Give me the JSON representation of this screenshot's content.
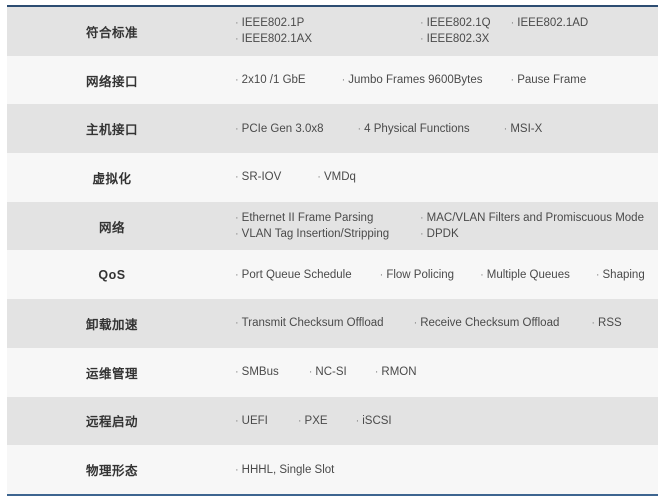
{
  "table": {
    "bullet": "·",
    "accent_top_color": "#2d4d72",
    "accent_bottom_color": "#3d6590",
    "row_odd_color": "#e3e3e3",
    "row_even_color": "#f7f7f7",
    "rows": [
      {
        "label": "符合标准",
        "lines": [
          [
            "IEEE802.1P",
            "IEEE802.1Q",
            "IEEE802.1AD"
          ],
          [
            "IEEE802.1AX",
            "IEEE802.3X"
          ]
        ]
      },
      {
        "label": "网络接口",
        "lines": [
          [
            "2x10 /1  GbE",
            "Jumbo Frames 9600Bytes",
            "Pause Frame"
          ]
        ]
      },
      {
        "label": "主机接口",
        "lines": [
          [
            "PCIe Gen 3.0x8",
            "4 Physical Functions",
            "MSI-X"
          ]
        ]
      },
      {
        "label": "虚拟化",
        "lines": [
          [
            "SR-IOV",
            "VMDq"
          ]
        ]
      },
      {
        "label": "网络",
        "lines": [
          [
            "Ethernet II Frame Parsing",
            "MAC/VLAN Filters and Promiscuous Mode"
          ],
          [
            "VLAN Tag Insertion/Stripping",
            "DPDK"
          ]
        ]
      },
      {
        "label": "QoS",
        "lines": [
          [
            "Port Queue Schedule",
            "Flow Policing",
            "Multiple Queues",
            "Shaping"
          ]
        ]
      },
      {
        "label": "卸载加速",
        "lines": [
          [
            "Transmit Checksum Offload",
            "Receive Checksum Offload",
            "RSS"
          ]
        ]
      },
      {
        "label": "运维管理",
        "lines": [
          [
            "SMBus",
            "NC-SI",
            "RMON"
          ]
        ]
      },
      {
        "label": "远程启动",
        "lines": [
          [
            "UEFI",
            "PXE",
            "iSCSI"
          ]
        ]
      },
      {
        "label": "物理形态",
        "lines": [
          [
            "HHHL, Single Slot"
          ]
        ]
      }
    ]
  }
}
